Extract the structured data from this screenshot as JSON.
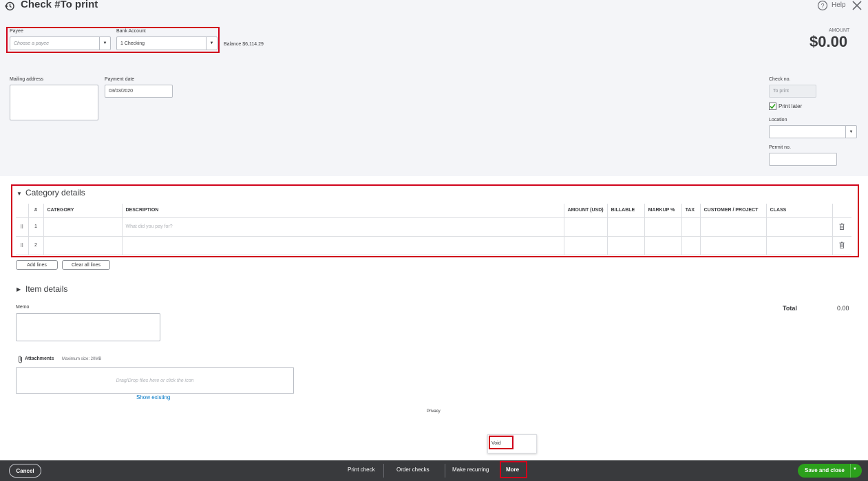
{
  "header": {
    "title": "Check #To print",
    "help_label": "Help",
    "amount_label": "AMOUNT",
    "amount_value": "$0.00"
  },
  "payee": {
    "label": "Payee",
    "placeholder": "Choose a payee"
  },
  "bank_account": {
    "label": "Bank Account",
    "value": "1 Checking",
    "balance": "Balance $6,114.29"
  },
  "mailing_address": {
    "label": "Mailing address",
    "value": ""
  },
  "payment_date": {
    "label": "Payment date",
    "value": "03/03/2020"
  },
  "check_no": {
    "label": "Check no.",
    "value": "To print"
  },
  "print_later": {
    "label": "Print later",
    "checked": true
  },
  "location": {
    "label": "Location",
    "value": ""
  },
  "permit_no": {
    "label": "Permit no.",
    "value": ""
  },
  "category_details": {
    "title": "Category details",
    "columns": [
      "#",
      "CATEGORY",
      "DESCRIPTION",
      "AMOUNT (USD)",
      "BILLABLE",
      "MARKUP %",
      "TAX",
      "CUSTOMER / PROJECT",
      "CLASS"
    ],
    "rows": [
      {
        "num": "1",
        "category": "",
        "description_placeholder": "What did you pay for?"
      },
      {
        "num": "2",
        "category": "",
        "description_placeholder": ""
      }
    ],
    "add_lines_label": "Add lines",
    "clear_lines_label": "Clear all lines"
  },
  "item_details": {
    "title": "Item details"
  },
  "memo": {
    "label": "Memo",
    "value": ""
  },
  "total": {
    "label": "Total",
    "value": "0.00"
  },
  "attachments": {
    "label": "Attachments",
    "max_size": "Maximum size: 20MB",
    "dropzone_text": "Drag/Drop files here or click the icon",
    "show_existing": "Show existing"
  },
  "privacy_label": "Privacy",
  "more_menu": {
    "void_label": "Void"
  },
  "footer": {
    "cancel": "Cancel",
    "print_check": "Print check",
    "order_checks": "Order checks",
    "make_recurring": "Make recurring",
    "more": "More",
    "save_and_close": "Save and close"
  },
  "colors": {
    "accent_green": "#2ca01c",
    "highlight_red": "#d0021b",
    "footer_bg": "#393a3d",
    "link_blue": "#0077c5"
  }
}
